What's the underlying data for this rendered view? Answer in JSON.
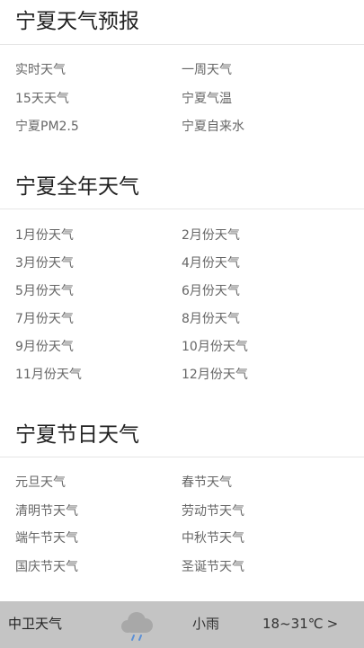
{
  "forecast": {
    "title": "宁夏天气预报",
    "links": [
      {
        "label": "实时天气"
      },
      {
        "label": "一周天气"
      },
      {
        "label": "15天天气"
      },
      {
        "label": "宁夏气温"
      },
      {
        "label": "宁夏PM2.5"
      },
      {
        "label": "宁夏自来水"
      }
    ]
  },
  "yearly": {
    "title": "宁夏全年天气",
    "links": [
      {
        "label": "1月份天气"
      },
      {
        "label": "2月份天气"
      },
      {
        "label": "3月份天气"
      },
      {
        "label": "4月份天气"
      },
      {
        "label": "5月份天气"
      },
      {
        "label": "6月份天气"
      },
      {
        "label": "7月份天气"
      },
      {
        "label": "8月份天气"
      },
      {
        "label": "9月份天气"
      },
      {
        "label": "10月份天气"
      },
      {
        "label": "11月份天气"
      },
      {
        "label": "12月份天气"
      }
    ]
  },
  "holiday": {
    "title": "宁夏节日天气",
    "links": [
      {
        "label": "元旦天气"
      },
      {
        "label": "春节天气"
      },
      {
        "label": "清明节天气"
      },
      {
        "label": "劳动节天气"
      },
      {
        "label": "端午节天气"
      },
      {
        "label": "中秋节天气"
      },
      {
        "label": "国庆节天气"
      },
      {
        "label": "圣诞节天气"
      }
    ]
  },
  "bottom_bar": {
    "city": "中卫天气",
    "icon": "rain-cloud-icon",
    "condition": "小雨",
    "temperature": "18~31℃",
    "arrow": ">",
    "colors": {
      "background": "#c4c4c4",
      "cloud": "#a8a8a8",
      "rain": "#5a8fd6"
    }
  }
}
